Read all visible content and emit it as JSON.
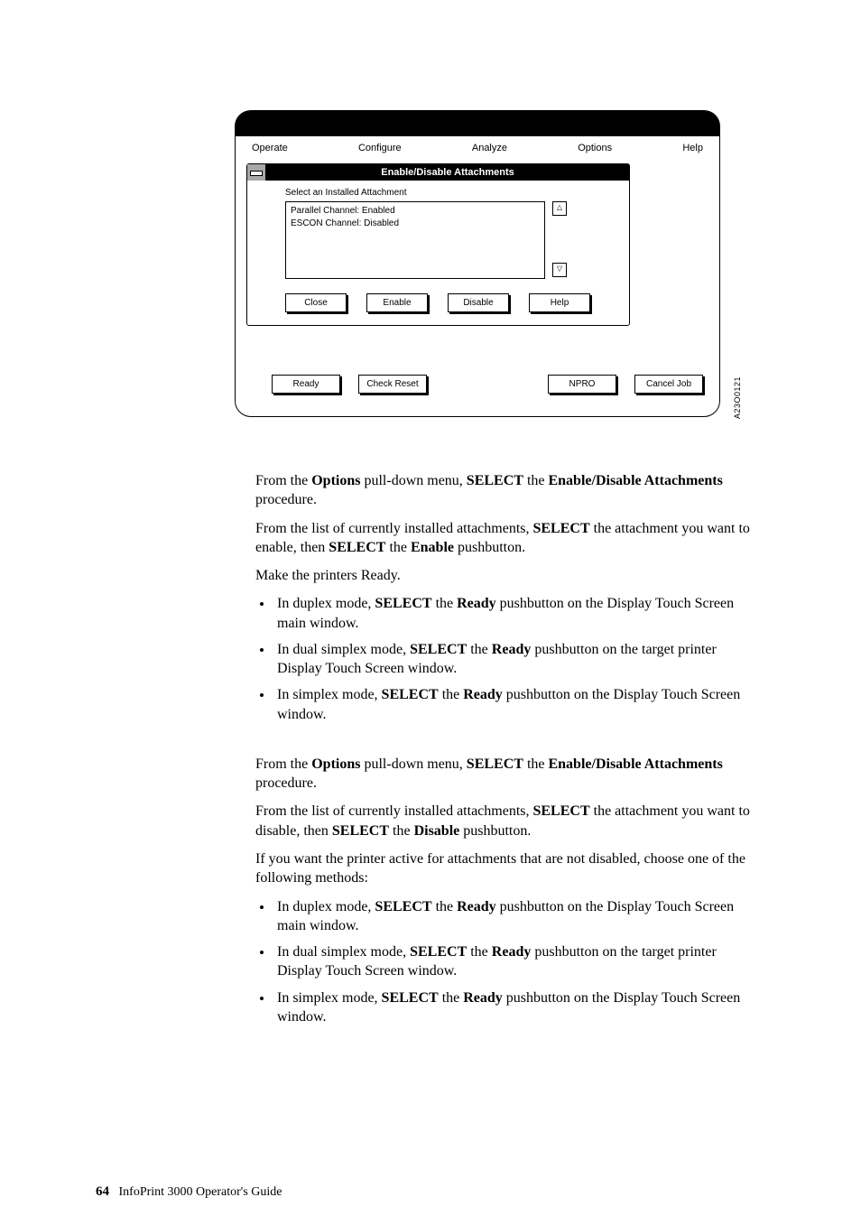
{
  "screenshot": {
    "menu": {
      "operate": "Operate",
      "configure": "Configure",
      "analyze": "Analyze",
      "options": "Options",
      "help": "Help"
    },
    "window": {
      "title": "Enable/Disable Attachments",
      "list_label": "Select an Installed Attachment",
      "items": [
        "Parallel Channel: Enabled",
        "ESCON Channel: Disabled"
      ],
      "buttons": {
        "close": "Close",
        "enable": "Enable",
        "disable": "Disable",
        "help": "Help"
      }
    },
    "footer_buttons": {
      "ready": "Ready",
      "check_reset": "Check Reset",
      "npro": "NPRO",
      "cancel_job": "Cancel Job"
    },
    "figure_id": "A23O0121"
  },
  "body": {
    "p1": {
      "t1": "From the ",
      "b1": "Options",
      "t2": " pull-down menu, ",
      "b2": "SELECT",
      "t3": " the ",
      "b3": "Enable/Disable Attachments",
      "t4": " procedure."
    },
    "p2": {
      "t1": "From the list of currently installed attachments, ",
      "b1": "SELECT",
      "t2": " the attachment you want to enable, then ",
      "b2": "SELECT",
      "t3": " the ",
      "b3": "Enable",
      "t4": " pushbutton."
    },
    "p3": "Make the printers Ready.",
    "list1": {
      "a": {
        "t1": "In duplex mode, ",
        "b1": "SELECT",
        "t2": " the ",
        "b2": "Ready",
        "t3": " pushbutton on the Display Touch Screen main window."
      },
      "b": {
        "t1": "In dual simplex mode, ",
        "b1": "SELECT",
        "t2": " the ",
        "b2": "Ready",
        "t3": " pushbutton on the target printer Display Touch Screen window."
      },
      "c": {
        "t1": "In simplex mode, ",
        "b1": "SELECT",
        "t2": " the ",
        "b2": "Ready",
        "t3": " pushbutton on the Display Touch Screen window."
      }
    },
    "p4": {
      "t1": "From the ",
      "b1": "Options",
      "t2": " pull-down menu, ",
      "b2": "SELECT",
      "t3": " the ",
      "b3": "Enable/Disable Attachments",
      "t4": " procedure."
    },
    "p5": {
      "t1": "From the list of currently installed attachments, ",
      "b1": "SELECT",
      "t2": " the attachment you want to disable, then ",
      "b2": "SELECT",
      "t3": " the ",
      "b3": "Disable",
      "t4": " pushbutton."
    },
    "p6": "If you want the printer active for attachments that are not disabled, choose one of the following methods:",
    "list2": {
      "a": {
        "t1": "In duplex mode, ",
        "b1": "SELECT",
        "t2": " the ",
        "b2": "Ready",
        "t3": " pushbutton on the Display Touch Screen main window."
      },
      "b": {
        "t1": "In dual simplex mode, ",
        "b1": "SELECT",
        "t2": " the ",
        "b2": "Ready",
        "t3": " pushbutton on the target printer Display Touch Screen window."
      },
      "c": {
        "t1": "In simplex mode, ",
        "b1": "SELECT",
        "t2": " the ",
        "b2": "Ready",
        "t3": " pushbutton on the Display Touch Screen window."
      }
    }
  },
  "footer": {
    "page_number": "64",
    "book_title": "InfoPrint 3000 Operator's Guide"
  }
}
